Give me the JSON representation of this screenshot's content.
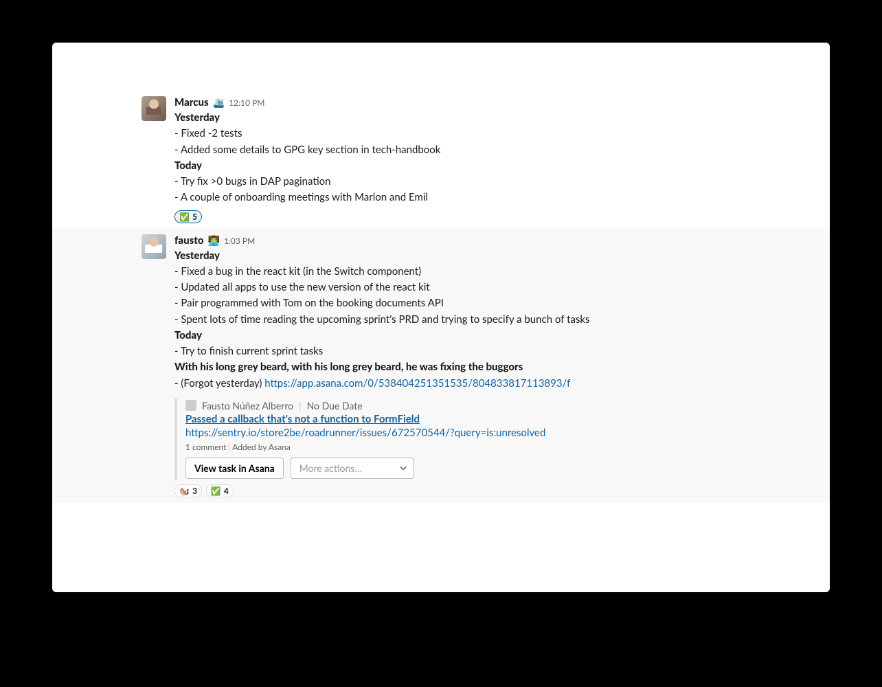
{
  "messages": [
    {
      "user": "Marcus",
      "status_emoji": "🛳️",
      "time": "12:10 PM",
      "sections": {
        "h1": "Yesterday",
        "y1": "- Fixed -2 tests",
        "y2": "- Added some details to GPG key section in tech-handbook",
        "h2": "Today",
        "t1": "- Try fix >0 bugs in DAP pagination",
        "t2": "- A couple of onboarding meetings with Marlon and Emil"
      },
      "reactions": [
        {
          "emoji": "✅",
          "count": "5"
        }
      ]
    },
    {
      "user": "fausto",
      "status_emoji": "👨‍💻",
      "time": "1:03 PM",
      "sections": {
        "h1": "Yesterday",
        "y1": "- Fixed a bug in the react kit (in the Switch component)",
        "y2": "- Updated all apps to use the new version of the react kit",
        "y3": "- Pair programmed with Tom on the booking documents API",
        "y4": "- Spent lots of time reading the upcoming sprint's PRD and trying to specify a bunch of tasks",
        "h2": "Today",
        "t1": "- Try to finish current sprint tasks",
        "b1": "With his long grey beard, with his long grey beard, he was fixing the buggors",
        "f_prefix": "- (Forgot yesterday) ",
        "f_link": "https://app.asana.com/0/538404251351535/804833817113893/f"
      },
      "attachment": {
        "assignee": "Fausto Núñez Alberro",
        "due": "No Due Date",
        "title": "Passed a callback that's not a function to FormField",
        "url": "https://sentry.io/store2be/roadrunner/issues/672570544/?query=is:unresolved",
        "comments": "1 comment",
        "added_by": "Added by Asana",
        "button": "View task in Asana",
        "more": "More actions…"
      },
      "reactions": [
        {
          "emoji": "🐿️",
          "count": "3"
        },
        {
          "emoji": "✅",
          "count": "4"
        }
      ]
    }
  ]
}
